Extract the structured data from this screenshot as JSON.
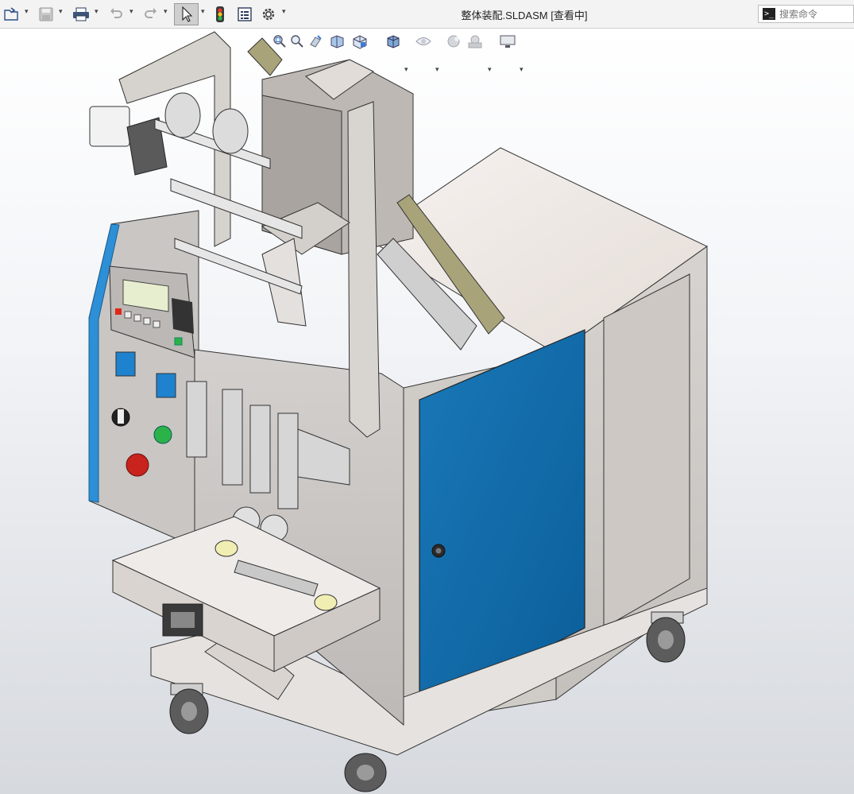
{
  "window": {
    "title": "整体装配.SLDASM [查看中]"
  },
  "toolbar": {
    "items": [
      {
        "name": "open-icon"
      },
      {
        "name": "save-icon"
      },
      {
        "name": "print-icon"
      },
      {
        "name": "undo-icon"
      },
      {
        "name": "redo-icon"
      },
      {
        "name": "select-pointer-icon"
      },
      {
        "name": "traffic-light-icon"
      },
      {
        "name": "file-properties-icon"
      },
      {
        "name": "options-gear-icon"
      }
    ]
  },
  "search": {
    "placeholder": "搜索命令"
  },
  "heads_up_toolbar": {
    "items": [
      {
        "name": "zoom-to-fit-icon"
      },
      {
        "name": "zoom-to-area-icon"
      },
      {
        "name": "previous-view-icon"
      },
      {
        "name": "section-view-icon"
      },
      {
        "name": "view-orientation-icon"
      },
      {
        "name": "display-style-icon"
      },
      {
        "name": "hide-show-items-icon"
      },
      {
        "name": "edit-appearance-icon"
      },
      {
        "name": "apply-scene-icon"
      },
      {
        "name": "view-settings-icon"
      }
    ]
  },
  "colors": {
    "accent_blue": "#0a6aa8",
    "panel_blue": "#2d8fd6",
    "machine_grey": "#cfcbc7",
    "olive_guide": "#a9a37a"
  }
}
